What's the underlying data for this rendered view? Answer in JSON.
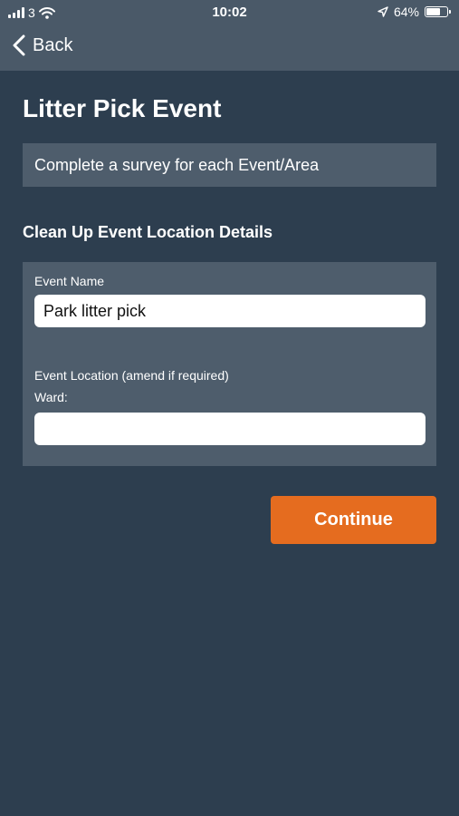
{
  "status_bar": {
    "carrier": "3",
    "time": "10:02",
    "battery": "64%",
    "battery_level": 0.64
  },
  "nav": {
    "back_label": "Back"
  },
  "page": {
    "title": "Litter Pick Event",
    "info_text": "Complete a survey for each Event/Area"
  },
  "form": {
    "section_title": "Clean Up Event Location Details",
    "event_name_label": "Event Name",
    "event_name_value": "Park litter pick",
    "location_label": "Event Location (amend if required)",
    "ward_label": "Ward:",
    "ward_value": ""
  },
  "actions": {
    "continue_label": "Continue"
  },
  "colors": {
    "background": "#2d3e4f",
    "header": "#4a5968",
    "panel": "#4e5d6c",
    "accent": "#e56c1f"
  },
  "icons": [
    "signal-icon",
    "wifi-icon",
    "location-arrow-icon",
    "battery-icon",
    "chevron-left-icon"
  ]
}
